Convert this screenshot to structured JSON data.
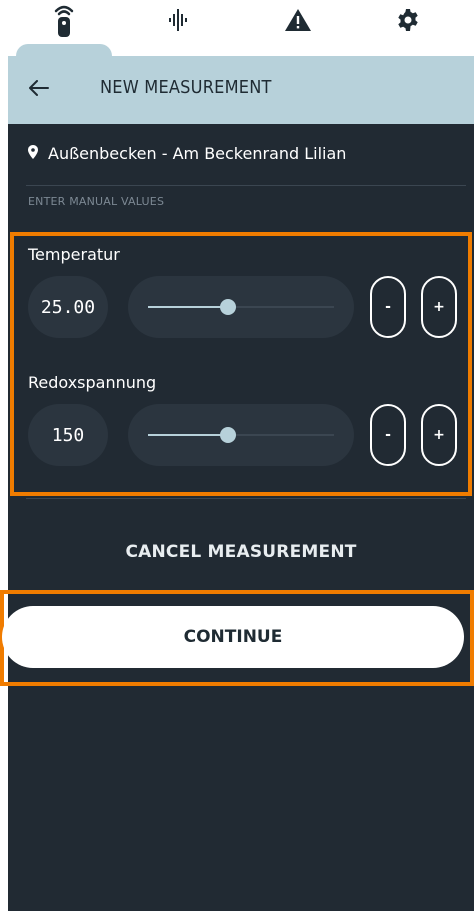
{
  "tabs": [
    {
      "icon": "remote-icon",
      "active": true
    },
    {
      "icon": "waveform-icon",
      "active": false
    },
    {
      "icon": "warning-icon",
      "active": false
    },
    {
      "icon": "gear-icon",
      "active": false
    }
  ],
  "header": {
    "title": "NEW MEASUREMENT",
    "back_icon": "arrow-left-icon"
  },
  "location": {
    "icon": "location-pin-icon",
    "text": "Außenbecken - Am Beckenrand Lilian"
  },
  "section_label": "ENTER MANUAL VALUES",
  "fields": [
    {
      "label": "Temperatur",
      "value": "25.00",
      "slider_level": 0.43,
      "minus": "-",
      "plus": "+"
    },
    {
      "label": "Redoxspannung",
      "value": "150",
      "slider_level": 0.43,
      "minus": "-",
      "plus": "+"
    }
  ],
  "actions": {
    "cancel_label": "CANCEL MEASUREMENT",
    "continue_label": "CONTINUE"
  },
  "colors": {
    "background": "#212a33",
    "header": "#b7d1da",
    "accent": "#f07c00",
    "pill": "#2b353f"
  }
}
